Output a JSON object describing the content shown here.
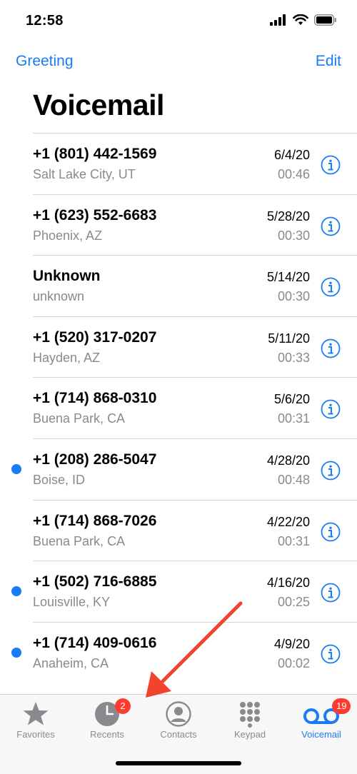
{
  "status": {
    "time": "12:58"
  },
  "nav": {
    "left_label": "Greeting",
    "right_label": "Edit"
  },
  "page": {
    "title": "Voicemail"
  },
  "voicemails": [
    {
      "caller": "+1 (801) 442-1569",
      "location": "Salt Lake City, UT",
      "date": "6/4/20",
      "duration": "00:46",
      "unread": false
    },
    {
      "caller": "+1 (623) 552-6683",
      "location": "Phoenix, AZ",
      "date": "5/28/20",
      "duration": "00:30",
      "unread": false
    },
    {
      "caller": "Unknown",
      "location": "unknown",
      "date": "5/14/20",
      "duration": "00:30",
      "unread": false
    },
    {
      "caller": "+1 (520) 317-0207",
      "location": "Hayden, AZ",
      "date": "5/11/20",
      "duration": "00:33",
      "unread": false
    },
    {
      "caller": "+1 (714) 868-0310",
      "location": "Buena Park, CA",
      "date": "5/6/20",
      "duration": "00:31",
      "unread": false
    },
    {
      "caller": "+1 (208) 286-5047",
      "location": "Boise, ID",
      "date": "4/28/20",
      "duration": "00:48",
      "unread": true
    },
    {
      "caller": "+1 (714) 868-7026",
      "location": "Buena Park, CA",
      "date": "4/22/20",
      "duration": "00:31",
      "unread": false
    },
    {
      "caller": "+1 (502) 716-6885",
      "location": "Louisville, KY",
      "date": "4/16/20",
      "duration": "00:25",
      "unread": true
    },
    {
      "caller": "+1 (714) 409-0616",
      "location": "Anaheim, CA",
      "date": "4/9/20",
      "duration": "00:02",
      "unread": true
    }
  ],
  "tabs": [
    {
      "label": "Favorites",
      "icon": "star-icon",
      "active": false
    },
    {
      "label": "Recents",
      "icon": "clock-icon",
      "active": false,
      "badge": "2"
    },
    {
      "label": "Contacts",
      "icon": "person-icon",
      "active": false
    },
    {
      "label": "Keypad",
      "icon": "keypad-icon",
      "active": false
    },
    {
      "label": "Voicemail",
      "icon": "voicemail-icon",
      "active": true,
      "badge": "19"
    }
  ],
  "colors": {
    "accent": "#1a7cf5",
    "badge": "#ff3b30",
    "annotation_arrow": "#f0452c",
    "secondary_text": "#8a8a8e"
  }
}
